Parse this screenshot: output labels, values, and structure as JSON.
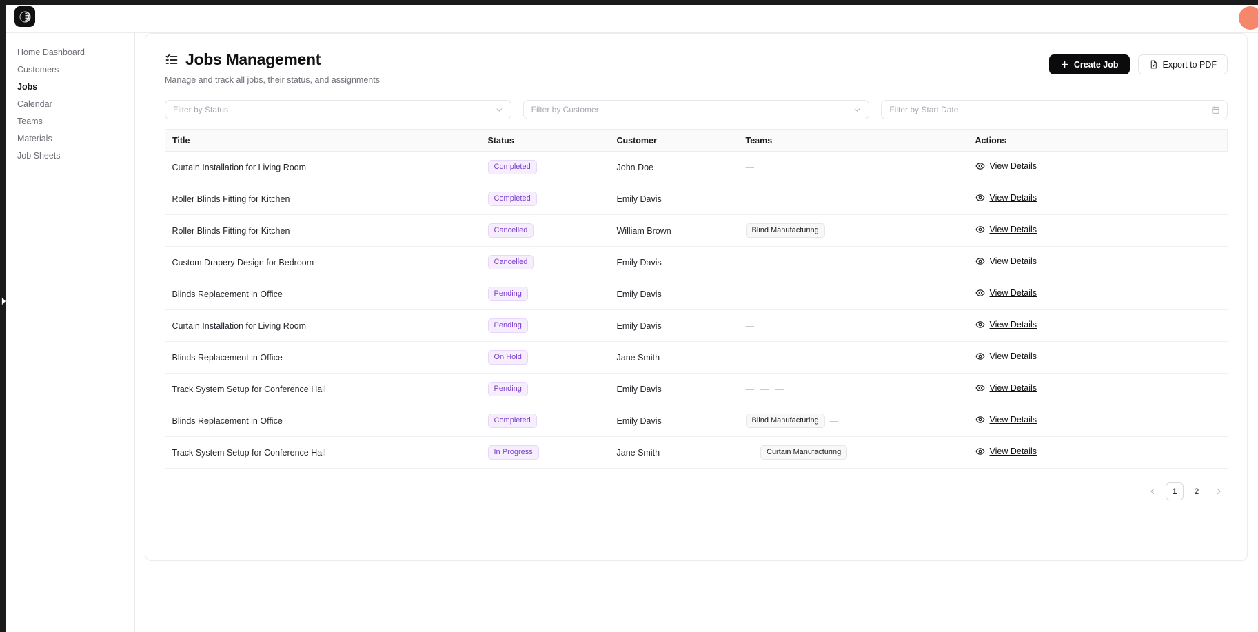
{
  "app": {
    "logo_icon": "circle-logo-icon",
    "avatar_color": "#f5886c"
  },
  "sidebar": {
    "items": [
      {
        "label": "Home Dashboard",
        "active": false
      },
      {
        "label": "Customers",
        "active": false
      },
      {
        "label": "Jobs",
        "active": true
      },
      {
        "label": "Calendar",
        "active": false
      },
      {
        "label": "Teams",
        "active": false
      },
      {
        "label": "Materials",
        "active": false
      },
      {
        "label": "Job Sheets",
        "active": false
      }
    ]
  },
  "header": {
    "title": "Jobs Management",
    "subtitle": "Manage and track all jobs, their status, and assignments",
    "title_icon": "list-checklist-icon",
    "create_button": "Create Job",
    "create_button_icon": "plus-icon",
    "export_button": "Export to PDF",
    "export_button_icon": "file-pdf-icon"
  },
  "filters": [
    {
      "placeholder": "Filter by Status",
      "icon": "chevron-down-icon"
    },
    {
      "placeholder": "Filter by Customer",
      "icon": "chevron-down-icon"
    },
    {
      "placeholder": "Filter by Start Date",
      "icon": "calendar-icon"
    }
  ],
  "table": {
    "columns": [
      "Title",
      "Status",
      "Customer",
      "Teams",
      "Actions"
    ],
    "action_label": "View Details",
    "action_icon": "eye-icon",
    "empty_mark": "—",
    "rows": [
      {
        "title": "Curtain Installation for Living Room",
        "status": "Completed",
        "customer": "John Doe",
        "teams": [
          "—"
        ]
      },
      {
        "title": "Roller Blinds Fitting for Kitchen",
        "status": "Completed",
        "customer": "Emily Davis",
        "teams": []
      },
      {
        "title": "Roller Blinds Fitting for Kitchen",
        "status": "Cancelled",
        "customer": "William Brown",
        "teams": [
          "Blind Manufacturing"
        ]
      },
      {
        "title": "Custom Drapery Design for Bedroom",
        "status": "Cancelled",
        "customer": "Emily Davis",
        "teams": [
          "—"
        ]
      },
      {
        "title": "Blinds Replacement in Office",
        "status": "Pending",
        "customer": "Emily Davis",
        "teams": []
      },
      {
        "title": "Curtain Installation for Living Room",
        "status": "Pending",
        "customer": "Emily Davis",
        "teams": [
          "—"
        ]
      },
      {
        "title": "Blinds Replacement in Office",
        "status": "On Hold",
        "customer": "Jane Smith",
        "teams": []
      },
      {
        "title": "Track System Setup for Conference Hall",
        "status": "Pending",
        "customer": "Emily Davis",
        "teams": [
          "—",
          "—",
          "—"
        ]
      },
      {
        "title": "Blinds Replacement in Office",
        "status": "Completed",
        "customer": "Emily Davis",
        "teams": [
          "Blind Manufacturing",
          "—"
        ]
      },
      {
        "title": "Track System Setup for Conference Hall",
        "status": "In Progress",
        "customer": "Jane Smith",
        "teams": [
          "—",
          "Curtain Manufacturing"
        ]
      }
    ]
  },
  "pagination": {
    "prev_icon": "chevron-left-icon",
    "next_icon": "chevron-right-icon",
    "pages": [
      "1",
      "2"
    ],
    "current": "1"
  },
  "colors": {
    "badge_bg": "#f6eefc",
    "badge_text": "#7b3fd1",
    "badge_border": "#e7d7f8",
    "primary_button_bg": "#0b0b0d",
    "accent_avatar": "#f5886c"
  }
}
